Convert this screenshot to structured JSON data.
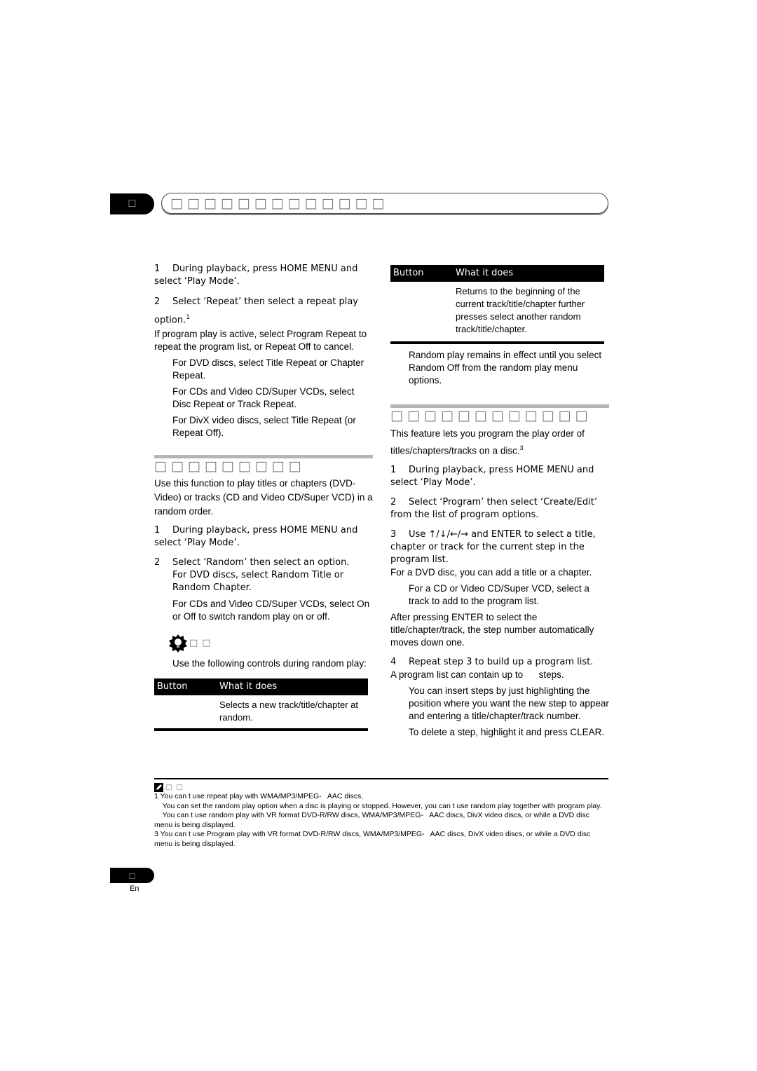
{
  "header": {
    "chapter_number": "□",
    "chapter_title": "□□□□□□□□□□□□□"
  },
  "left": {
    "repeat_steps": [
      {
        "num": "1",
        "text": "During playback, press HOME MENU and select ‘Play Mode’."
      },
      {
        "num": "2",
        "text": "Select ‘Repeat’ then select a repeat play option.",
        "footnote": "1"
      }
    ],
    "repeat_note": "If program play is active, select Program Repeat to repeat the program list, or Repeat Off to cancel.",
    "repeat_bullets": [
      "For DVD discs, select Title Repeat or Chapter Repeat.",
      "For CDs and Video CD/Super VCDs, select Disc Repeat or Track Repeat.",
      "For DivX video discs, select Title Repeat (or Repeat Off)."
    ],
    "random_heading": "□□□□□□□□□",
    "random_intro": "Use this function to play titles or chapters (DVD-Video) or tracks (CD and Video CD/Super VCD) in a random order.",
    "random_steps": [
      {
        "num": "1",
        "text": "During playback, press HOME MENU and select ‘Play Mode’."
      },
      {
        "num": "2",
        "text": "Select ‘Random’ then select an option."
      }
    ],
    "random_bullets": [
      "For DVD discs, select Random Title or Random Chapter.",
      "For CDs and Video CD/Super VCDs, select On or Off to switch random play on or off."
    ],
    "tip_label": "□□",
    "tip_text": "Use the following controls during random play:",
    "table": {
      "col1": "Button",
      "col2": "What it does",
      "rows": [
        {
          "button": "",
          "does": "Selects a new track/title/chapter at random."
        }
      ]
    }
  },
  "right": {
    "table": {
      "col1": "Button",
      "col2": "What it does",
      "rows": [
        {
          "button": "",
          "does": "Returns to the beginning of the current track/title/chapter further presses select another random track/title/chapter."
        }
      ]
    },
    "random_remains": "Random play remains in effect until you select Random Off from the random play menu options.",
    "program_heading": "□□□□□□□□□□□□",
    "program_intro": "This feature lets you program the play order of titles/chapters/tracks on a disc.",
    "program_intro_footnote": "3",
    "program_steps": [
      {
        "num": "1",
        "text": "During playback, press HOME MENU and select ‘Play Mode’."
      },
      {
        "num": "2",
        "text": "Select ‘Program’ then select ‘Create/Edit’ from the list of program options."
      },
      {
        "num": "3",
        "text": "Use ↑/↓/←/→ and ENTER to select a title, chapter or track for the current step in the program list."
      }
    ],
    "step3_note": "For a DVD disc, you can add a title or a chapter.",
    "step3_bullet": "For a CD or Video CD/Super VCD, select a track to add to the program list.",
    "step3_after": "After pressing ENTER to select the title/chapter/track, the step number automatically moves down one.",
    "step4": {
      "num": "4",
      "text": "Repeat step 3 to build up a program list."
    },
    "step4_note": "A program list can contain up to      steps.",
    "step4_bullets": [
      "You can insert steps by just highlighting the position where you want the new step to appear and entering a title/chapter/track number.",
      "To delete a step, highlight it and press CLEAR."
    ]
  },
  "notes": {
    "label": "□□",
    "items": [
      "1 You can t use repeat play with WMA/MP3/MPEG-   AAC discs.",
      "    You can set the random play option when a disc is playing or stopped. However, you can t use random play together with program play.",
      "    You can t use random play with VR format DVD-R/RW discs, WMA/MP3/MPEG-   AAC discs, DivX video discs, or while a DVD disc menu is being displayed.",
      "3 You can t use Program play with VR format DVD-R/RW discs, WMA/MP3/MPEG-   AAC discs, DivX video discs, or while a DVD disc menu is being displayed."
    ]
  },
  "footer": {
    "page_number": "□",
    "language": "En"
  }
}
